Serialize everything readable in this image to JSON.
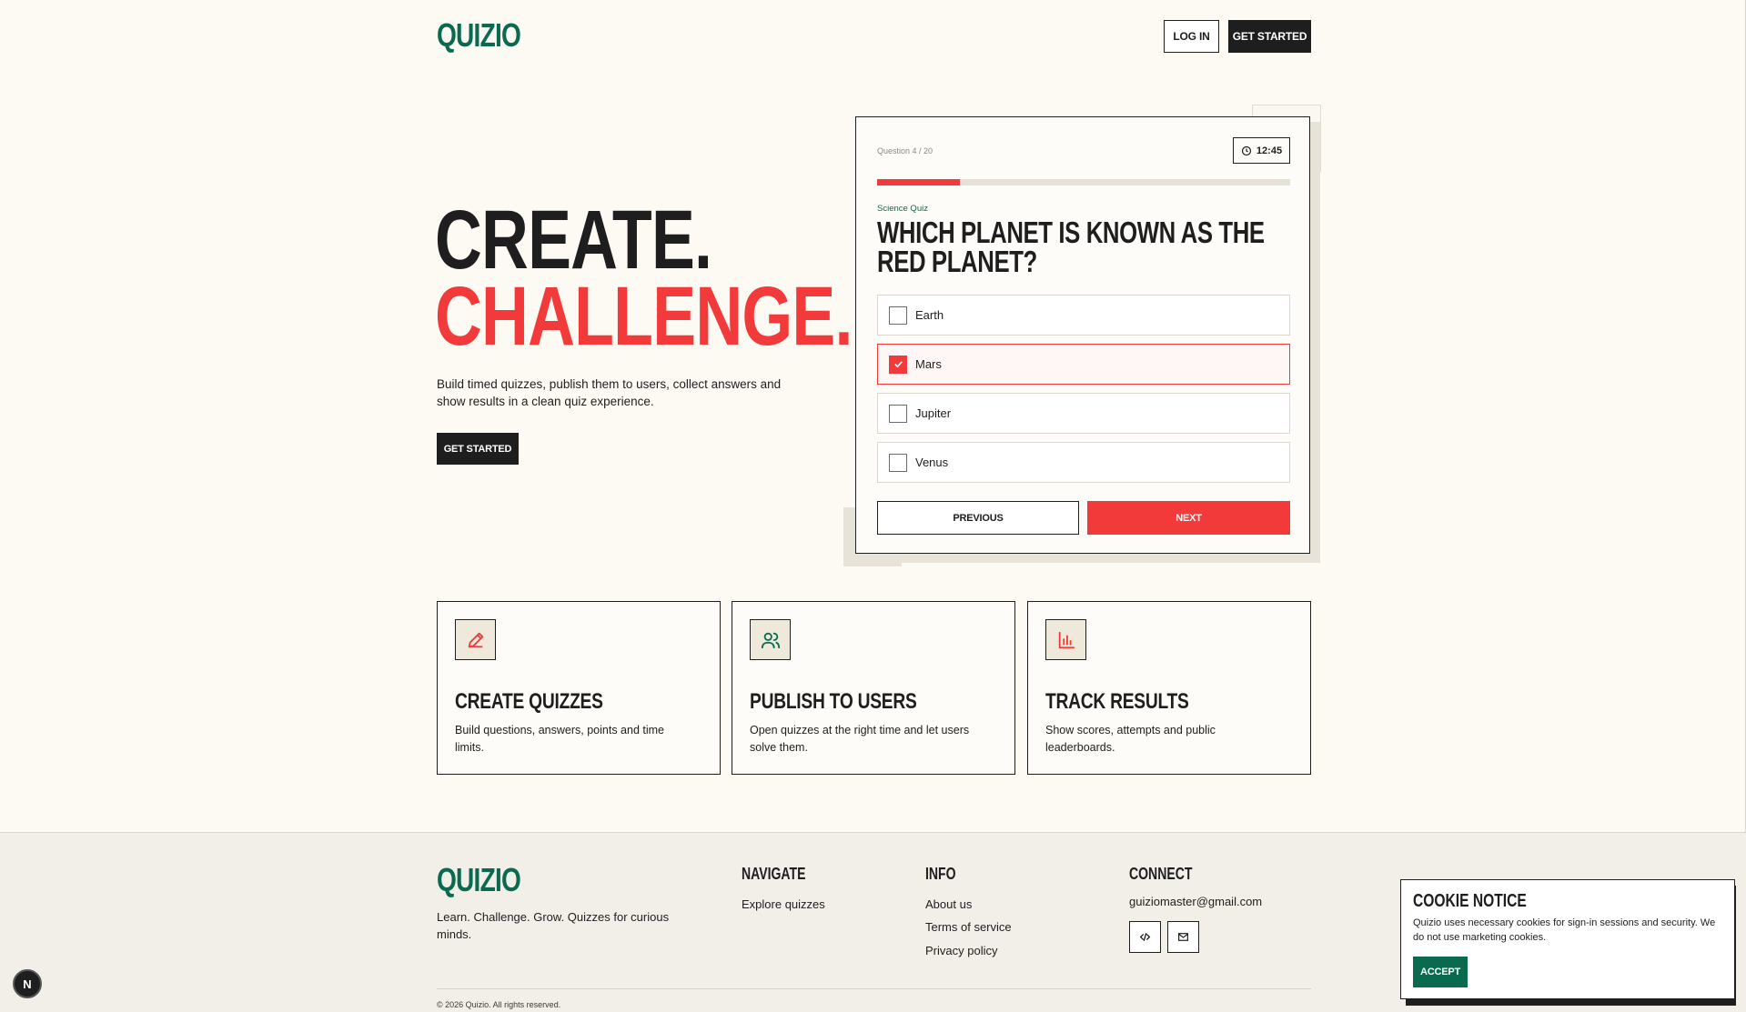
{
  "brand": {
    "name": "QUIZIO",
    "color": "#0a6a4f",
    "accent": "#f33a3a"
  },
  "header": {
    "login_label": "LOG IN",
    "get_started_label": "GET STARTED"
  },
  "hero": {
    "title_line1": "CREATE.",
    "title_line2": "CHALLENGE.",
    "description": "Build timed quizzes, publish them to users, collect answers and show results in a clean quiz experience.",
    "cta_label": "GET STARTED"
  },
  "quiz": {
    "counter": "Question 4 / 20",
    "timer": "12:45",
    "progress": 0.2,
    "topic": "Science Quiz",
    "question": "Which planet is known as the Red Planet?",
    "options": [
      {
        "label": "Earth",
        "selected": false
      },
      {
        "label": "Mars",
        "selected": true
      },
      {
        "label": "Jupiter",
        "selected": false
      },
      {
        "label": "Venus",
        "selected": false
      }
    ],
    "previous_label": "PREVIOUS",
    "next_label": "NEXT"
  },
  "features": [
    {
      "title": "CREATE QUIZZES",
      "description": "Build questions, answers, points and time limits.",
      "icon": "pencil-icon"
    },
    {
      "title": "PUBLISH TO USERS",
      "description": "Open quizzes at the right time and let users solve them.",
      "icon": "users-icon"
    },
    {
      "title": "TRACK RESULTS",
      "description": "Show scores, attempts and public leaderboards.",
      "icon": "bar-chart-icon"
    }
  ],
  "footer": {
    "logo": "QUIZIO",
    "tagline": "Learn. Challenge. Grow. Quizzes for curious minds.",
    "navigate": {
      "heading": "NAVIGATE",
      "links": [
        "Explore quizzes"
      ]
    },
    "info": {
      "heading": "INFO",
      "links": [
        "About us",
        "Terms of service",
        "Privacy policy"
      ]
    },
    "connect": {
      "heading": "CONNECT",
      "email": "guiziomaster@gmail.com",
      "icons": [
        "code-icon",
        "mail-icon"
      ]
    },
    "copyright": "© 2026 Quizio. All rights reserved."
  },
  "badge": {
    "letter": "N"
  },
  "cookie": {
    "title": "COOKIE NOTICE",
    "text": "Quizio uses necessary cookies for sign-in sessions and security. We do not use marketing cookies.",
    "accept_label": "ACCEPT"
  }
}
